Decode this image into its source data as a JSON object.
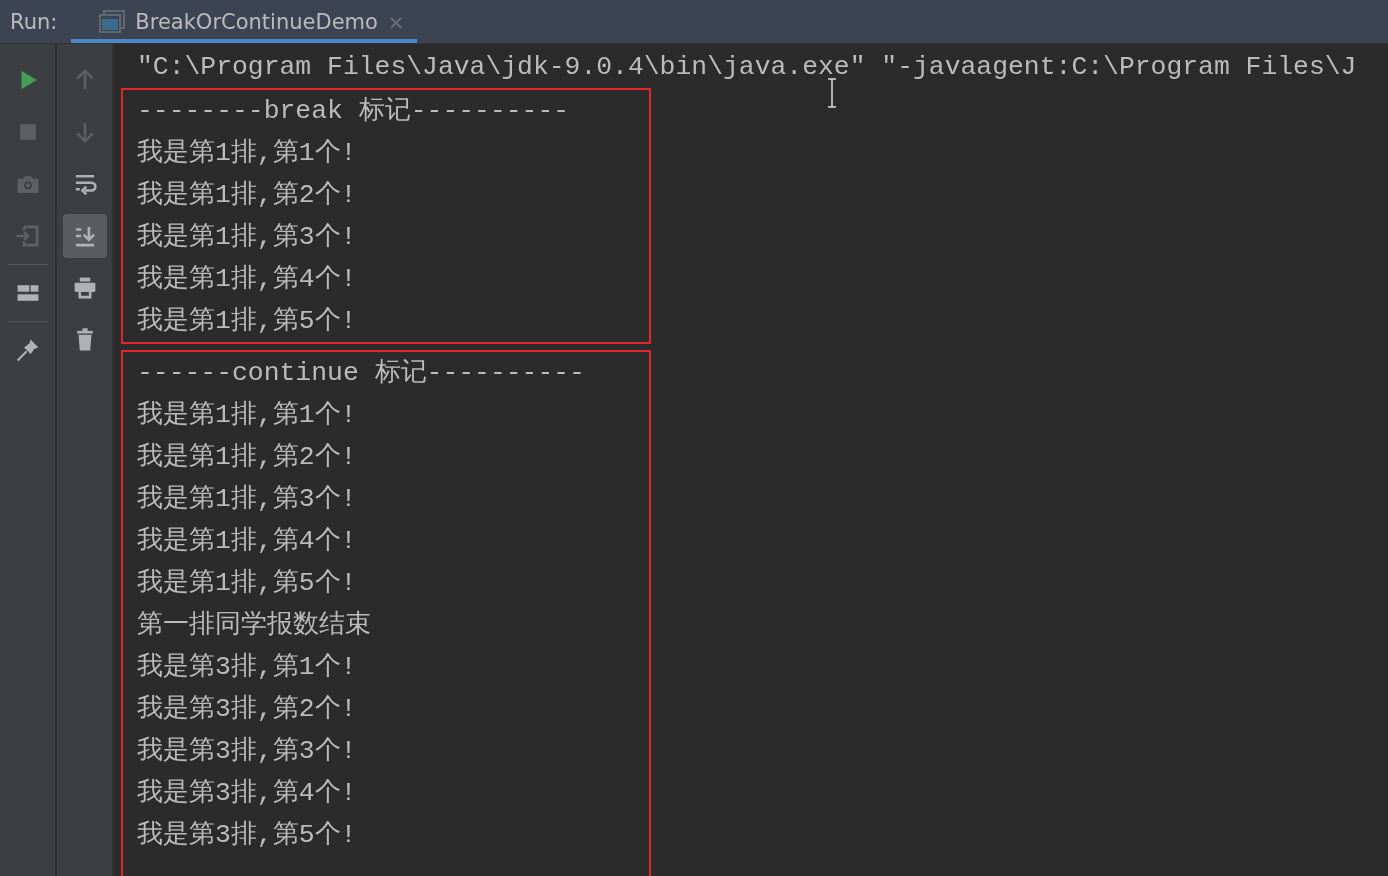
{
  "header": {
    "label": "Run:",
    "tab": {
      "title": "BreakOrContinueDemo",
      "selected": true,
      "close": "×"
    }
  },
  "toolbar_left": [
    {
      "kind": "run",
      "disabled": false
    },
    {
      "kind": "stop",
      "disabled": true
    },
    {
      "kind": "camera",
      "disabled": true
    },
    {
      "kind": "import",
      "disabled": true
    },
    {
      "kind": "layout",
      "disabled": false
    },
    {
      "kind": "pin",
      "disabled": false
    }
  ],
  "toolbar_right": [
    {
      "kind": "up",
      "disabled": true,
      "selected": false
    },
    {
      "kind": "down",
      "disabled": true,
      "selected": false
    },
    {
      "kind": "wrap",
      "disabled": false,
      "selected": false
    },
    {
      "kind": "scroll-end",
      "disabled": false,
      "selected": true
    },
    {
      "kind": "print",
      "disabled": false,
      "selected": false
    },
    {
      "kind": "trash",
      "disabled": false,
      "selected": false
    }
  ],
  "console": {
    "command": "\"C:\\Program Files\\Java\\jdk-9.0.4\\bin\\java.exe\" \"-javaagent:C:\\Program Files\\J",
    "groups": [
      {
        "lines": [
          "--------break 标记----------",
          "我是第1排,第1个!",
          "我是第1排,第2个!",
          "我是第1排,第3个!",
          "我是第1排,第4个!",
          "我是第1排,第5个!"
        ]
      },
      {
        "lines": [
          "------continue 标记----------",
          "我是第1排,第1个!",
          "我是第1排,第2个!",
          "我是第1排,第3个!",
          "我是第1排,第4个!",
          "我是第1排,第5个!",
          "第一排同学报数结束",
          "我是第3排,第1个!",
          "我是第3排,第2个!",
          "我是第3排,第3个!",
          "我是第3排,第4个!",
          "我是第3排,第5个!"
        ]
      }
    ]
  }
}
